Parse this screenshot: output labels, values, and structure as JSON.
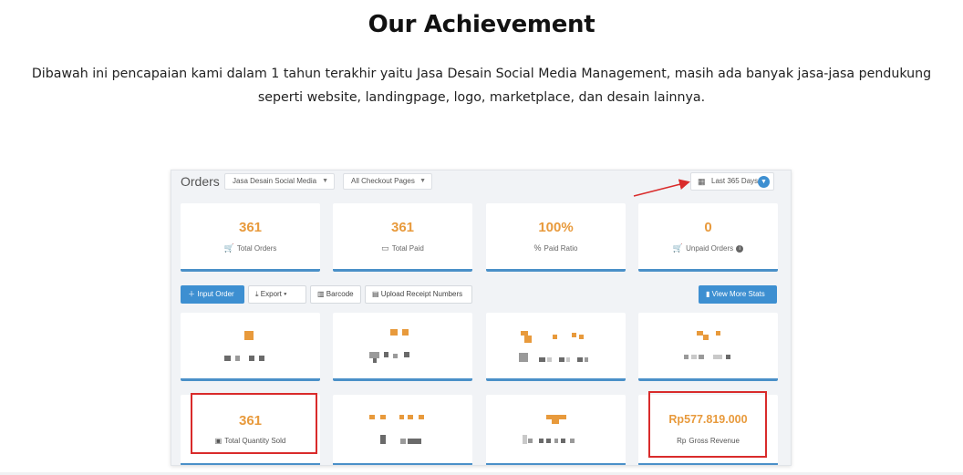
{
  "page": {
    "heading": "Our Achievement",
    "intro": "Dibawah ini pencapaian kami dalam 1 tahun terakhir yaitu Jasa Desain Social Media Management, masih ada banyak jasa-jasa pendukung seperti website, landingpage, logo, marketplace, dan desain lainnya."
  },
  "dashboard": {
    "title": "Orders",
    "filter_product": "Jasa Desain Social Media",
    "filter_page": "All Checkout Pages",
    "date_range": "Last 365 Days",
    "stats": [
      {
        "value": "361",
        "label": "Total Orders",
        "icon": "cart-icon"
      },
      {
        "value": "361",
        "label": "Total Paid",
        "icon": "card-icon"
      },
      {
        "value": "100%",
        "label": "Paid Ratio",
        "icon": "percent-icon"
      },
      {
        "value": "0",
        "label": "Unpaid Orders",
        "icon": "cart-icon"
      }
    ],
    "toolbar": {
      "input_order": "Input Order",
      "export": "Export",
      "barcode": "Barcode",
      "upload_receipt": "Upload Receipt Numbers",
      "view_more": "View More Stats"
    },
    "bottom_stats": {
      "quantity_value": "361",
      "quantity_label": "Total Quantity Sold",
      "revenue_value": "Rp577.819.000",
      "revenue_label": "Gross Revenue",
      "revenue_icon_text": "Rp"
    },
    "colors": {
      "accent": "#3d8fd1",
      "value": "#e89a3c",
      "highlight": "#d92b2b"
    }
  }
}
